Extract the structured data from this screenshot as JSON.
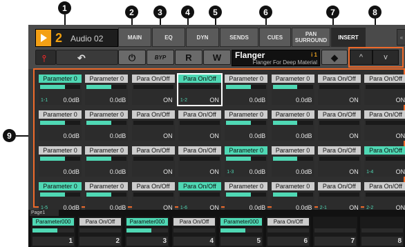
{
  "callouts": [
    "1",
    "2",
    "3",
    "4",
    "5",
    "6",
    "7",
    "8",
    "9"
  ],
  "header": {
    "track_number": "2",
    "track_name": "Audio 02",
    "tabs": [
      {
        "label": "MAIN"
      },
      {
        "label": "EQ"
      },
      {
        "label": "DYN"
      },
      {
        "label": "SENDS"
      },
      {
        "label": "CUES"
      },
      {
        "label": "PAN SURROUND"
      },
      {
        "label": "INSERT",
        "active": true
      }
    ],
    "bypass_label": "BYP",
    "read_label": "R",
    "write_label": "W",
    "plugin_name": "Flanger",
    "plugin_slot": "i 1",
    "plugin_description": "Flanger For Deep Material",
    "up_label": "^",
    "down_label": "v"
  },
  "grid": {
    "rows": [
      [
        {
          "name": "Parameter 0",
          "value": "0.0dB",
          "index": "1-1",
          "fill": 0.62,
          "hi": true
        },
        {
          "name": "Parameter 0",
          "value": "0.0dB",
          "index": "",
          "fill": 0.62,
          "hi": false
        },
        {
          "name": "Para On/Off",
          "value": "ON",
          "index": "",
          "fill": 0,
          "hi": false
        },
        {
          "name": "Para On/Off",
          "value": "ON",
          "index": "1-2",
          "fill": 0,
          "hi": true,
          "sel": true
        },
        {
          "name": "Parameter 0",
          "value": "0.0dB",
          "index": "",
          "fill": 0.62,
          "hi": false
        },
        {
          "name": "Parameter 0",
          "value": "0.0dB",
          "index": "",
          "fill": 0.62,
          "hi": false
        },
        {
          "name": "Para On/Off",
          "value": "ON",
          "index": "",
          "fill": 0,
          "hi": false
        },
        {
          "name": "Para On/Off",
          "value": "ON",
          "index": "",
          "fill": 0,
          "hi": false
        }
      ],
      [
        {
          "name": "Parameter 0",
          "value": "0.0dB",
          "index": "",
          "fill": 0.62,
          "hi": false
        },
        {
          "name": "Parameter 0",
          "value": "0.0dB",
          "index": "",
          "fill": 0.62,
          "hi": false
        },
        {
          "name": "Para On/Off",
          "value": "ON",
          "index": "",
          "fill": 0,
          "hi": false
        },
        {
          "name": "Para On/Off",
          "value": "ON",
          "index": "",
          "fill": 0,
          "hi": false
        },
        {
          "name": "Parameter 0",
          "value": "0.0dB",
          "index": "",
          "fill": 0.62,
          "hi": false
        },
        {
          "name": "Parameter 0",
          "value": "0.0dB",
          "index": "",
          "fill": 0.62,
          "hi": false
        },
        {
          "name": "Para On/Off",
          "value": "ON",
          "index": "",
          "fill": 0,
          "hi": false
        },
        {
          "name": "Para On/Off",
          "value": "ON",
          "index": "",
          "fill": 0,
          "hi": false
        }
      ],
      [
        {
          "name": "Parameter 0",
          "value": "0.0dB",
          "index": "",
          "fill": 0.62,
          "hi": false
        },
        {
          "name": "Parameter 0",
          "value": "0.0dB",
          "index": "",
          "fill": 0.62,
          "hi": false
        },
        {
          "name": "Para On/Off",
          "value": "ON",
          "index": "",
          "fill": 0,
          "hi": false
        },
        {
          "name": "Para On/Off",
          "value": "ON",
          "index": "",
          "fill": 0,
          "hi": false
        },
        {
          "name": "Parameter 0",
          "value": "0.0dB",
          "index": "1-3",
          "fill": 0.62,
          "hi": true
        },
        {
          "name": "Parameter 0",
          "value": "0.0dB",
          "index": "",
          "fill": 0.62,
          "hi": false
        },
        {
          "name": "Para On/Off",
          "value": "ON",
          "index": "",
          "fill": 0,
          "hi": false
        },
        {
          "name": "Para On/Off",
          "value": "ON",
          "index": "1-4",
          "fill": 0,
          "hi": true
        }
      ],
      [
        {
          "name": "Parameter 0",
          "value": "0.0dB",
          "index": "1-5",
          "fill": 0.62,
          "hi": true
        },
        {
          "name": "Parameter 0",
          "value": "0.0dB",
          "index": "",
          "fill": 0.62,
          "hi": false
        },
        {
          "name": "Para On/Off",
          "value": "ON",
          "index": "",
          "fill": 0,
          "hi": false
        },
        {
          "name": "Para On/Off",
          "value": "ON",
          "index": "1-6",
          "fill": 0,
          "hi": true
        },
        {
          "name": "Parameter 0",
          "value": "0.0dB",
          "index": "",
          "fill": 0.62,
          "hi": false
        },
        {
          "name": "Parameter 0",
          "value": "0.0dB",
          "index": "",
          "fill": 0.62,
          "hi": false
        },
        {
          "name": "Para On/Off",
          "value": "ON",
          "index": "2-1",
          "fill": 0,
          "hi": false
        },
        {
          "name": "Para On/Off",
          "value": "ON",
          "index": "2-2",
          "fill": 0,
          "hi": false
        }
      ]
    ]
  },
  "bottom": {
    "page_label": "Page1",
    "knobs": [
      {
        "name": "Parameter000",
        "num": "1",
        "fill": 0.6,
        "hi": true
      },
      {
        "name": "Para On/Off",
        "num": "2",
        "fill": 0,
        "hi": false
      },
      {
        "name": "Parameter000",
        "num": "3",
        "fill": 0.6,
        "hi": true
      },
      {
        "name": "Para On/Off",
        "num": "4",
        "fill": 0,
        "hi": false
      },
      {
        "name": "Parameter000",
        "num": "5",
        "fill": 0.6,
        "hi": true
      },
      {
        "name": "Para On/Off",
        "num": "6",
        "fill": 0,
        "hi": false
      },
      {
        "name": "",
        "num": "7",
        "fill": 0,
        "hi": false
      },
      {
        "name": "",
        "num": "8",
        "fill": 0,
        "hi": false
      }
    ]
  },
  "colors": {
    "accent": "#4fd8b4",
    "callout_frame": "#ef6a2a",
    "track_orange": "#f4a015"
  }
}
